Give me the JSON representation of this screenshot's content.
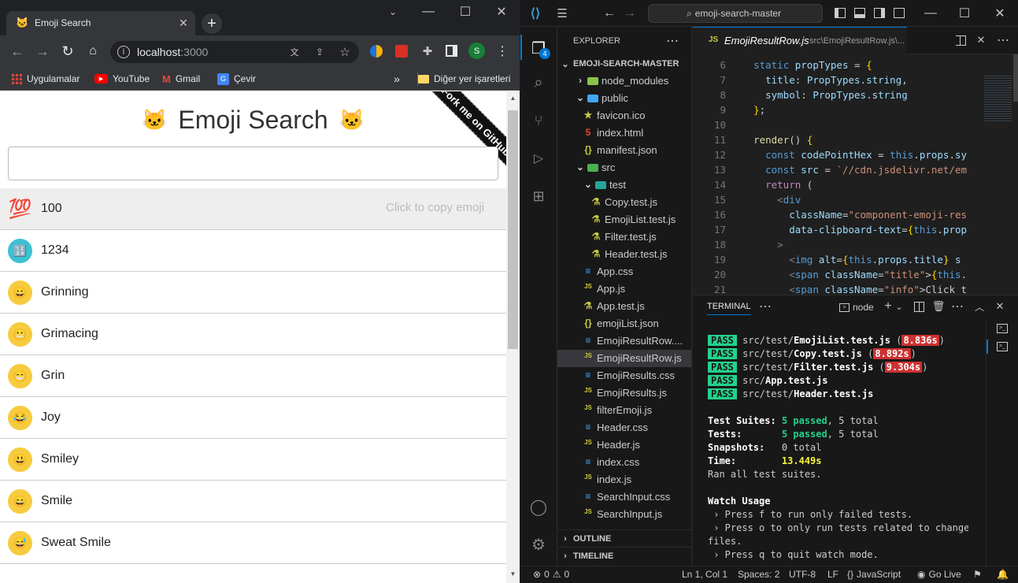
{
  "browser": {
    "tab_title": "Emoji Search",
    "url_host": "localhost",
    "url_port": ":3000",
    "avatar_letter": "S",
    "bookmarks": [
      "Uygulamalar",
      "YouTube",
      "Gmail",
      "Çevir"
    ],
    "other_bookmarks": "Diğer yer işaretleri",
    "page": {
      "title": "Emoji Search",
      "ribbon": "Fork me on GitHub",
      "search_value": "",
      "copy_hint": "Click to copy emoji",
      "rows": [
        {
          "title": "100",
          "icon": "💯"
        },
        {
          "title": "1234",
          "icon": "🔢"
        },
        {
          "title": "Grinning",
          "icon": "😀"
        },
        {
          "title": "Grimacing",
          "icon": "😬"
        },
        {
          "title": "Grin",
          "icon": "😁"
        },
        {
          "title": "Joy",
          "icon": "😂"
        },
        {
          "title": "Smiley",
          "icon": "😃"
        },
        {
          "title": "Smile",
          "icon": "😄"
        },
        {
          "title": "Sweat Smile",
          "icon": "😅"
        }
      ]
    }
  },
  "vscode": {
    "search_placeholder": "emoji-search-master",
    "explorer_label": "EXPLORER",
    "folder": "EMOJI-SEARCH-MASTER",
    "badge": "4",
    "tree": [
      {
        "label": "node_modules",
        "kind": "folder-closed",
        "indent": 1
      },
      {
        "label": "public",
        "kind": "folder-open",
        "indent": 1
      },
      {
        "label": "favicon.ico",
        "kind": "star",
        "indent": 2
      },
      {
        "label": "index.html",
        "kind": "html",
        "indent": 2
      },
      {
        "label": "manifest.json",
        "kind": "json",
        "indent": 2
      },
      {
        "label": "src",
        "kind": "folder-open",
        "indent": 1
      },
      {
        "label": "test",
        "kind": "folder-open",
        "indent": 2
      },
      {
        "label": "Copy.test.js",
        "kind": "test",
        "indent": 3
      },
      {
        "label": "EmojiList.test.js",
        "kind": "test",
        "indent": 3
      },
      {
        "label": "Filter.test.js",
        "kind": "test",
        "indent": 3
      },
      {
        "label": "Header.test.js",
        "kind": "test",
        "indent": 3
      },
      {
        "label": "App.css",
        "kind": "css",
        "indent": 2
      },
      {
        "label": "App.js",
        "kind": "js",
        "indent": 2
      },
      {
        "label": "App.test.js",
        "kind": "test",
        "indent": 2
      },
      {
        "label": "emojiList.json",
        "kind": "json",
        "indent": 2
      },
      {
        "label": "EmojiResultRow....",
        "kind": "css",
        "indent": 2
      },
      {
        "label": "EmojiResultRow.js",
        "kind": "js",
        "indent": 2,
        "selected": true
      },
      {
        "label": "EmojiResults.css",
        "kind": "css",
        "indent": 2
      },
      {
        "label": "EmojiResults.js",
        "kind": "js",
        "indent": 2
      },
      {
        "label": "filterEmoji.js",
        "kind": "js",
        "indent": 2
      },
      {
        "label": "Header.css",
        "kind": "css",
        "indent": 2
      },
      {
        "label": "Header.js",
        "kind": "js",
        "indent": 2
      },
      {
        "label": "index.css",
        "kind": "css",
        "indent": 2
      },
      {
        "label": "index.js",
        "kind": "js",
        "indent": 2
      },
      {
        "label": "SearchInput.css",
        "kind": "css",
        "indent": 2
      },
      {
        "label": "SearchInput.js",
        "kind": "js",
        "indent": 2
      }
    ],
    "outline_label": "OUTLINE",
    "timeline_label": "TIMELINE",
    "editor_tab": "EmojiResultRow.js",
    "editor_path": "src\\EmojiResultRow.js\\...",
    "code_lines": [
      {
        "n": "6",
        "html": "  <span class=kw>static</span> <span class=pr>propTypes</span> = <span class=pu>{</span>"
      },
      {
        "n": "7",
        "html": "    <span class=pr>title</span>: <span class=pr>PropTypes</span>.<span class=pr>string</span>,"
      },
      {
        "n": "8",
        "html": "    <span class=pr>symbol</span>: <span class=pr>PropTypes</span>.<span class=pr>string</span>"
      },
      {
        "n": "9",
        "html": "  <span class=pu>}</span>;"
      },
      {
        "n": "10",
        "html": ""
      },
      {
        "n": "11",
        "html": "  <span class=fn>render</span>() <span class=pu>{</span>"
      },
      {
        "n": "12",
        "html": "    <span class=kw>const</span> <span class=pr>codePointHex</span> = <span class=kw>this</span>.<span class=pr>props</span>.<span class=pr>sy</span>"
      },
      {
        "n": "13",
        "html": "    <span class=kw>const</span> <span class=pr>src</span> = <span class=st>`//cdn.jsdelivr.net/em</span>"
      },
      {
        "n": "14",
        "html": "    <span style=\"color:#c586c0\">return</span> ("
      },
      {
        "n": "15",
        "html": "      <span style=\"color:#808080\">&lt;</span><span class=tg>div</span>"
      },
      {
        "n": "16",
        "html": "        <span class=pr>className</span>=<span class=st>\"component-emoji-res</span>"
      },
      {
        "n": "17",
        "html": "        <span class=pr>data-clipboard-text</span>=<span class=pu>{</span><span class=kw>this</span>.<span class=pr>prop</span>"
      },
      {
        "n": "18",
        "html": "      <span style=\"color:#808080\">&gt;</span>"
      },
      {
        "n": "19",
        "html": "        <span style=\"color:#808080\">&lt;</span><span class=tg>img</span> <span class=pr>alt</span>=<span class=pu>{</span><span class=kw>this</span>.<span class=pr>props</span>.<span class=pr>title</span><span class=pu>}</span> <span class=pr>s</span>"
      },
      {
        "n": "20",
        "html": "        <span style=\"color:#808080\">&lt;</span><span class=tg>span</span> <span class=pr>className</span>=<span class=st>\"title\"</span>&gt;<span class=pu>{</span><span class=kw>this</span>."
      },
      {
        "n": "21",
        "html": "        <span style=\"color:#808080\">&lt;</span><span class=tg>span</span> <span class=pr>className</span>=<span class=st>\"info\"</span>&gt;Click t"
      }
    ],
    "panel_tab": "TERMINAL",
    "terminal_shell": "node",
    "terminal_lines": [
      "<span class=pass>PASS</span> src/test/<span class=b>EmojiList.test.js</span> (<span class=slow>8.836s</span>)",
      "<span class=pass>PASS</span> src/test/<span class=b>Copy.test.js</span> (<span class=slow>8.892s</span>)",
      "<span class=pass>PASS</span> src/test/<span class=b>Filter.test.js</span> (<span class=slow>9.304s</span>)",
      "<span class=pass>PASS</span> src/<span class=b>App.test.js</span>",
      "<span class=pass>PASS</span> src/test/<span class=b>Header.test.js</span>",
      "",
      "<span class=b>Test Suites:</span> <span class=grn>5 passed</span>, 5 total",
      "<span class=b>Tests:</span>       <span class=grn>5 passed</span>, 5 total",
      "<span class=b>Snapshots:</span>   0 total",
      "<span class=b>Time:</span>        <span class=yel>13.449s</span>",
      "Ran all test suites.",
      "",
      "<span class=b>Watch Usage</span>",
      " › Press f to run only failed tests.",
      " › Press o to only run tests related to changed",
      "files.",
      " › Press q to quit watch mode."
    ],
    "status": {
      "errors": "0",
      "warnings": "0",
      "position": "Ln 1, Col 1",
      "spaces": "Spaces: 2",
      "encoding": "UTF-8",
      "eol": "LF",
      "language": "JavaScript",
      "golive": "Go Live"
    }
  }
}
